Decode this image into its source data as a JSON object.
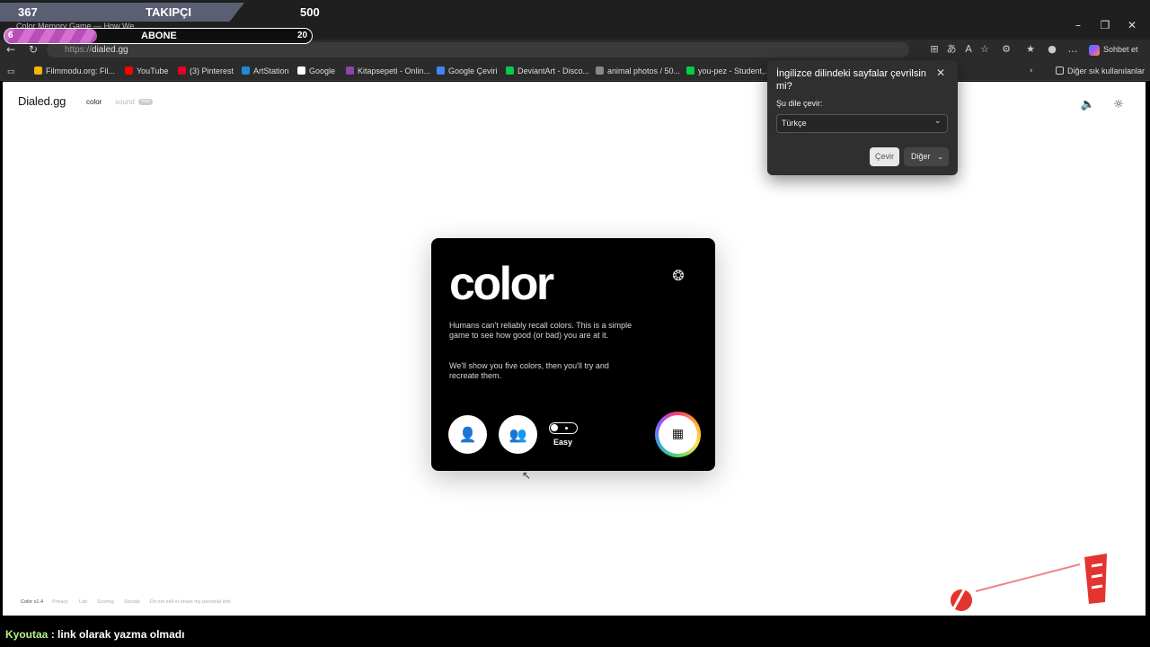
{
  "browser": {
    "tab_title": "Color Memory Game — How We...",
    "url_scheme": "https://",
    "url_host": "dialed.gg",
    "copilot_label": "Sohbet et",
    "bookmarks": [
      {
        "label": "Filmmodu.org: Fil...",
        "color": "#f5b400"
      },
      {
        "label": "YouTube",
        "color": "#ff0000"
      },
      {
        "label": "(3) Pinterest",
        "color": "#e60023"
      },
      {
        "label": "ArtStation",
        "color": "#1f8bd8"
      },
      {
        "label": "Google",
        "color": "#ffffff"
      },
      {
        "label": "Kitapsepeti - Onlin...",
        "color": "#8e44ad"
      },
      {
        "label": "Google Çeviri",
        "color": "#4285f4"
      },
      {
        "label": "DeviantArt - Disco...",
        "color": "#05cc47"
      },
      {
        "label": "animal photos / 50...",
        "color": "#888888"
      },
      {
        "label": "you-pez - Student,...",
        "color": "#05cc47"
      }
    ],
    "other_bookmarks": "Diğer sık kullanılanlar"
  },
  "site": {
    "logo": "Dialed.gg",
    "nav_color": "color",
    "nav_sound": "sound",
    "nav_badge": "new"
  },
  "game_card": {
    "title": "color",
    "paragraph1": "Humans can't reliably recall colors. This is a simple game to see how good (or bad) you are at it.",
    "paragraph2": "We'll show you five colors, then you'll try and recreate them.",
    "difficulty_label": "Easy"
  },
  "footer": [
    "Color v1.4",
    "Privacy",
    "Lab",
    "Scoring",
    "Socials",
    "Do not sell or share my personal info"
  ],
  "translate_popup": {
    "title": "İngilizce dilindeki sayfalar çevrilsin mi?",
    "label": "Şu dile çevir:",
    "selected_language": "Türkçe",
    "translate_button": "Çevir",
    "more_button": "Diğer"
  },
  "stream_overlay": {
    "followers_current": "367",
    "followers_label": "TAKIPÇI",
    "followers_goal": "500",
    "subs_current": "6",
    "subs_label": "ABONE",
    "subs_goal": "20",
    "subs_progress": 0.3,
    "chat_user": "Kyoutaa",
    "chat_message": ": link olarak yazma olmadı"
  },
  "icons": {
    "back": "back-arrow-icon",
    "reload": "reload-icon",
    "speaker": "speaker-icon",
    "theme": "sun-icon",
    "laurel": "laurel-icon",
    "single_player": "person-icon",
    "multiplayer": "group-icon",
    "daily": "calendar-icon"
  }
}
